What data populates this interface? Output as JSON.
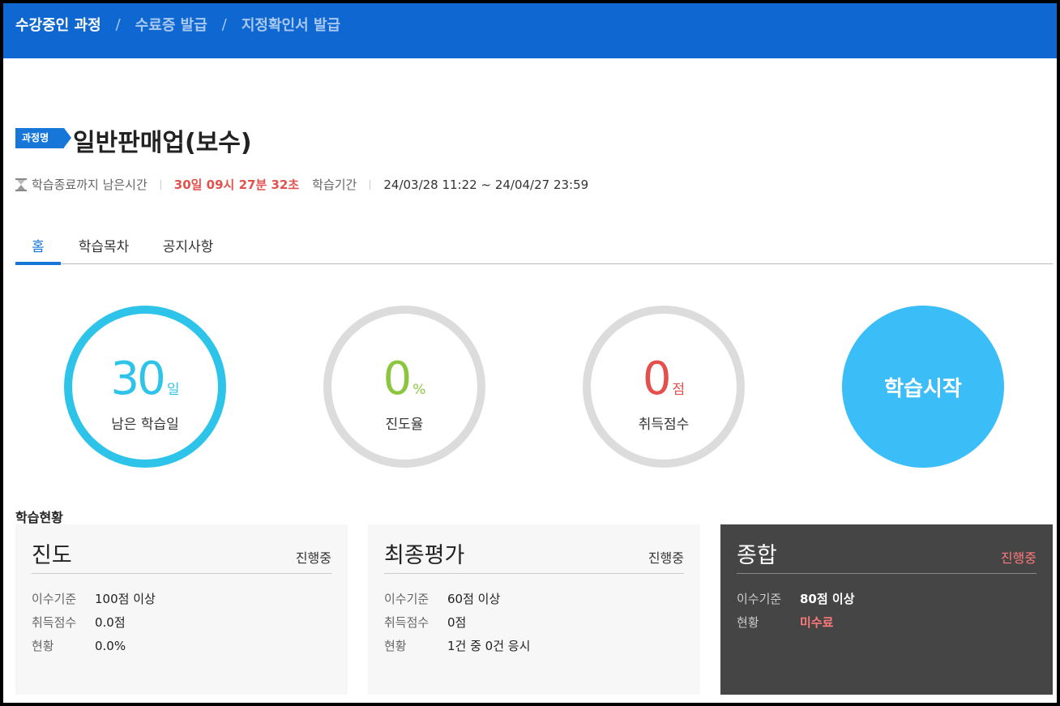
{
  "breadcrumb": {
    "items": [
      "수강중인 과정",
      "수료증 발급",
      "지정확인서 발급"
    ],
    "separator": "/"
  },
  "course": {
    "badge": "과정명",
    "title": "일반판매업(보수)"
  },
  "meta": {
    "remaining_label": "학습종료까지 남은시간",
    "remaining_value": "30일 09시 27분 32초",
    "period_label": "학습기간",
    "period_value": "24/03/28 11:22 ~ 24/04/27 23:59"
  },
  "tabs": [
    {
      "label": "홈",
      "active": true
    },
    {
      "label": "학습목차",
      "active": false
    },
    {
      "label": "공지사항",
      "active": false
    }
  ],
  "stats": {
    "days": {
      "value": "30",
      "unit": "일",
      "label": "남은 학습일",
      "color": "#2ec4ea"
    },
    "progress": {
      "value": "0",
      "unit": "%",
      "label": "진도율",
      "color": "#8cc63f"
    },
    "score": {
      "value": "0",
      "unit": "점",
      "label": "취득점수",
      "color": "#e4504c"
    }
  },
  "start_button": "학습시작",
  "status_section": {
    "title": "학습현황",
    "cards": [
      {
        "title": "진도",
        "status": "진행중",
        "rows": [
          {
            "key": "이수기준",
            "value": "100점 이상"
          },
          {
            "key": "취득점수",
            "value": "0.0점"
          },
          {
            "key": "현황",
            "value": "0.0%"
          }
        ]
      },
      {
        "title": "최종평가",
        "status": "진행중",
        "rows": [
          {
            "key": "이수기준",
            "value": "60점 이상"
          },
          {
            "key": "취득점수",
            "value": "0점"
          },
          {
            "key": "현황",
            "value": "1건 중 0건 응시"
          }
        ]
      },
      {
        "title": "종합",
        "status": "진행중",
        "rows": [
          {
            "key": "이수기준",
            "value": "80점 이상"
          },
          {
            "key": "현황",
            "value": "미수료"
          }
        ]
      }
    ]
  },
  "colors": {
    "header": "#0f67d2",
    "accent": "#1677d8",
    "alert": "#e4504c"
  }
}
